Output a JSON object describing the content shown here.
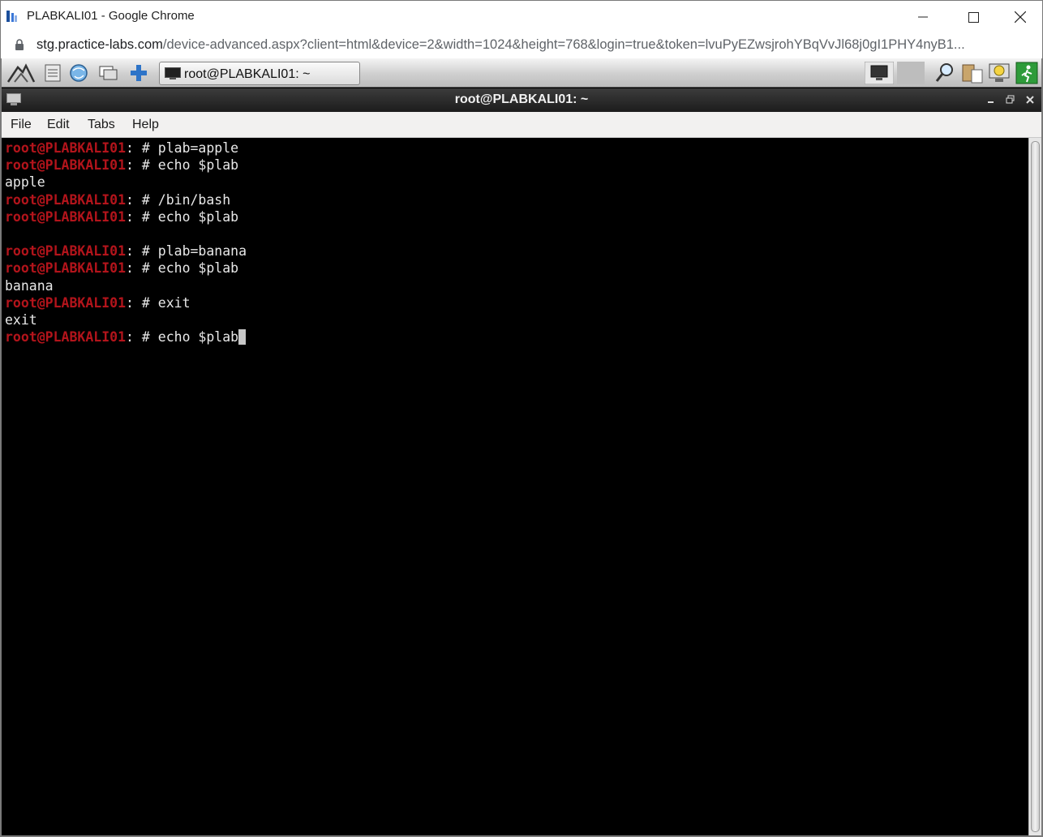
{
  "browser": {
    "title": "PLABKALI01 - Google Chrome",
    "url_domain": "stg.practice-labs.com",
    "url_path": "/device-advanced.aspx?client=html&device=2&width=1024&height=768&login=true&token=lvuPyEZwsjrohYBqVvJl68j0gI1PHY4nyB1..."
  },
  "taskbar": {
    "task_label": "root@PLABKALI01: ~"
  },
  "terminal": {
    "title": "root@PLABKALI01: ~",
    "menu": [
      "File",
      "Edit",
      "Tabs",
      "Help"
    ],
    "prompt": "root@PLABKALI01",
    "prompt_sep": ": # ",
    "lines": [
      {
        "type": "cmd",
        "text": "plab=apple"
      },
      {
        "type": "cmd",
        "text": "echo $plab"
      },
      {
        "type": "out",
        "text": "apple"
      },
      {
        "type": "cmd",
        "text": "/bin/bash"
      },
      {
        "type": "cmd",
        "text": "echo $plab"
      },
      {
        "type": "out",
        "text": ""
      },
      {
        "type": "cmd",
        "text": "plab=banana"
      },
      {
        "type": "cmd",
        "text": "echo $plab"
      },
      {
        "type": "out",
        "text": "banana"
      },
      {
        "type": "cmd",
        "text": "exit"
      },
      {
        "type": "out",
        "text": "exit"
      },
      {
        "type": "cmd",
        "text": "echo $plab"
      }
    ]
  },
  "colors": {
    "prompt": "#b3141b",
    "terminal_bg": "#000000",
    "terminal_fg": "#e8e8e8"
  }
}
